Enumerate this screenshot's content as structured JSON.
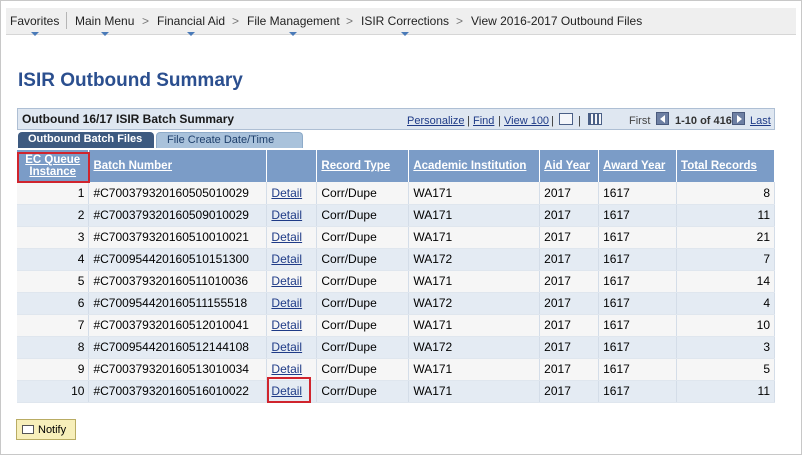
{
  "breadcrumb": {
    "items": [
      "Favorites",
      "Main Menu",
      "Financial Aid",
      "File Management",
      "ISIR Corrections",
      "View 2016-2017 Outbound Files"
    ],
    "separator": ">"
  },
  "page": {
    "title": "ISIR Outbound Summary"
  },
  "grid": {
    "title": "Outbound 16/17 ISIR Batch Summary",
    "toolbar": {
      "personalize": "Personalize",
      "find": "Find",
      "view_all": "View 100",
      "first": "First",
      "range": "1-10 of 416",
      "last": "Last",
      "bar": "|"
    },
    "tabs": [
      "Outbound Batch Files",
      "File Create Date/Time"
    ],
    "columns": [
      "EC Queue Instance",
      "Batch Number",
      "",
      "Record Type",
      "Academic Institution",
      "Aid Year",
      "Award Year",
      "Total Records"
    ],
    "rows": [
      [
        "1",
        "#C70037932016050501002​9",
        "Detail",
        "Corr/Dupe",
        "WA171",
        "2017",
        "1617",
        "8"
      ],
      [
        "2",
        "#C70037932016050901002​9",
        "Detail",
        "Corr/Dupe",
        "WA171",
        "2017",
        "1617",
        "11"
      ],
      [
        "3",
        "#C70037932016051001002​1",
        "Detail",
        "Corr/Dupe",
        "WA171",
        "2017",
        "1617",
        "21"
      ],
      [
        "4",
        "#C70095442016051015130​0",
        "Detail",
        "Corr/Dupe",
        "WA172",
        "2017",
        "1617",
        "7"
      ],
      [
        "5",
        "#C70037932016051101003​6",
        "Detail",
        "Corr/Dupe",
        "WA171",
        "2017",
        "1617",
        "14"
      ],
      [
        "6",
        "#C70095442016051115551​8",
        "Detail",
        "Corr/Dupe",
        "WA172",
        "2017",
        "1617",
        "4"
      ],
      [
        "7",
        "#C70037932016051201004​1",
        "Detail",
        "Corr/Dupe",
        "WA171",
        "2017",
        "1617",
        "10"
      ],
      [
        "8",
        "#C70095442016051214410​8",
        "Detail",
        "Corr/Dupe",
        "WA172",
        "2017",
        "1617",
        "3"
      ],
      [
        "9",
        "#C70037932016051301003​4",
        "Detail",
        "Corr/Dupe",
        "WA171",
        "2017",
        "1617",
        "5"
      ],
      [
        "10",
        "#C70037932016051601002​2",
        "Detail",
        "Corr/Dupe",
        "WA171",
        "2017",
        "1617",
        "11"
      ]
    ]
  },
  "notify": {
    "label": "Notify"
  },
  "colors": {
    "header_blue": "#7b9cc7",
    "title_blue": "#2b4f8f",
    "highlight_red": "#d0242d",
    "notify_yellow": "#f7efba"
  }
}
